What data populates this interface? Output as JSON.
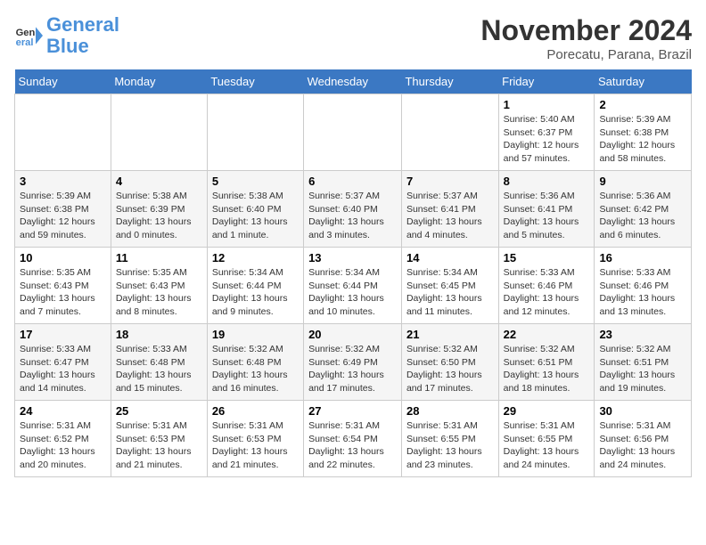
{
  "header": {
    "logo_line1": "General",
    "logo_line2": "Blue",
    "month": "November 2024",
    "location": "Porecatu, Parana, Brazil"
  },
  "days_of_week": [
    "Sunday",
    "Monday",
    "Tuesday",
    "Wednesday",
    "Thursday",
    "Friday",
    "Saturday"
  ],
  "weeks": [
    [
      {
        "day": "",
        "info": ""
      },
      {
        "day": "",
        "info": ""
      },
      {
        "day": "",
        "info": ""
      },
      {
        "day": "",
        "info": ""
      },
      {
        "day": "",
        "info": ""
      },
      {
        "day": "1",
        "info": "Sunrise: 5:40 AM\nSunset: 6:37 PM\nDaylight: 12 hours and 57 minutes."
      },
      {
        "day": "2",
        "info": "Sunrise: 5:39 AM\nSunset: 6:38 PM\nDaylight: 12 hours and 58 minutes."
      }
    ],
    [
      {
        "day": "3",
        "info": "Sunrise: 5:39 AM\nSunset: 6:38 PM\nDaylight: 12 hours and 59 minutes."
      },
      {
        "day": "4",
        "info": "Sunrise: 5:38 AM\nSunset: 6:39 PM\nDaylight: 13 hours and 0 minutes."
      },
      {
        "day": "5",
        "info": "Sunrise: 5:38 AM\nSunset: 6:40 PM\nDaylight: 13 hours and 1 minute."
      },
      {
        "day": "6",
        "info": "Sunrise: 5:37 AM\nSunset: 6:40 PM\nDaylight: 13 hours and 3 minutes."
      },
      {
        "day": "7",
        "info": "Sunrise: 5:37 AM\nSunset: 6:41 PM\nDaylight: 13 hours and 4 minutes."
      },
      {
        "day": "8",
        "info": "Sunrise: 5:36 AM\nSunset: 6:41 PM\nDaylight: 13 hours and 5 minutes."
      },
      {
        "day": "9",
        "info": "Sunrise: 5:36 AM\nSunset: 6:42 PM\nDaylight: 13 hours and 6 minutes."
      }
    ],
    [
      {
        "day": "10",
        "info": "Sunrise: 5:35 AM\nSunset: 6:43 PM\nDaylight: 13 hours and 7 minutes."
      },
      {
        "day": "11",
        "info": "Sunrise: 5:35 AM\nSunset: 6:43 PM\nDaylight: 13 hours and 8 minutes."
      },
      {
        "day": "12",
        "info": "Sunrise: 5:34 AM\nSunset: 6:44 PM\nDaylight: 13 hours and 9 minutes."
      },
      {
        "day": "13",
        "info": "Sunrise: 5:34 AM\nSunset: 6:44 PM\nDaylight: 13 hours and 10 minutes."
      },
      {
        "day": "14",
        "info": "Sunrise: 5:34 AM\nSunset: 6:45 PM\nDaylight: 13 hours and 11 minutes."
      },
      {
        "day": "15",
        "info": "Sunrise: 5:33 AM\nSunset: 6:46 PM\nDaylight: 13 hours and 12 minutes."
      },
      {
        "day": "16",
        "info": "Sunrise: 5:33 AM\nSunset: 6:46 PM\nDaylight: 13 hours and 13 minutes."
      }
    ],
    [
      {
        "day": "17",
        "info": "Sunrise: 5:33 AM\nSunset: 6:47 PM\nDaylight: 13 hours and 14 minutes."
      },
      {
        "day": "18",
        "info": "Sunrise: 5:33 AM\nSunset: 6:48 PM\nDaylight: 13 hours and 15 minutes."
      },
      {
        "day": "19",
        "info": "Sunrise: 5:32 AM\nSunset: 6:48 PM\nDaylight: 13 hours and 16 minutes."
      },
      {
        "day": "20",
        "info": "Sunrise: 5:32 AM\nSunset: 6:49 PM\nDaylight: 13 hours and 17 minutes."
      },
      {
        "day": "21",
        "info": "Sunrise: 5:32 AM\nSunset: 6:50 PM\nDaylight: 13 hours and 17 minutes."
      },
      {
        "day": "22",
        "info": "Sunrise: 5:32 AM\nSunset: 6:51 PM\nDaylight: 13 hours and 18 minutes."
      },
      {
        "day": "23",
        "info": "Sunrise: 5:32 AM\nSunset: 6:51 PM\nDaylight: 13 hours and 19 minutes."
      }
    ],
    [
      {
        "day": "24",
        "info": "Sunrise: 5:31 AM\nSunset: 6:52 PM\nDaylight: 13 hours and 20 minutes."
      },
      {
        "day": "25",
        "info": "Sunrise: 5:31 AM\nSunset: 6:53 PM\nDaylight: 13 hours and 21 minutes."
      },
      {
        "day": "26",
        "info": "Sunrise: 5:31 AM\nSunset: 6:53 PM\nDaylight: 13 hours and 21 minutes."
      },
      {
        "day": "27",
        "info": "Sunrise: 5:31 AM\nSunset: 6:54 PM\nDaylight: 13 hours and 22 minutes."
      },
      {
        "day": "28",
        "info": "Sunrise: 5:31 AM\nSunset: 6:55 PM\nDaylight: 13 hours and 23 minutes."
      },
      {
        "day": "29",
        "info": "Sunrise: 5:31 AM\nSunset: 6:55 PM\nDaylight: 13 hours and 24 minutes."
      },
      {
        "day": "30",
        "info": "Sunrise: 5:31 AM\nSunset: 6:56 PM\nDaylight: 13 hours and 24 minutes."
      }
    ]
  ]
}
